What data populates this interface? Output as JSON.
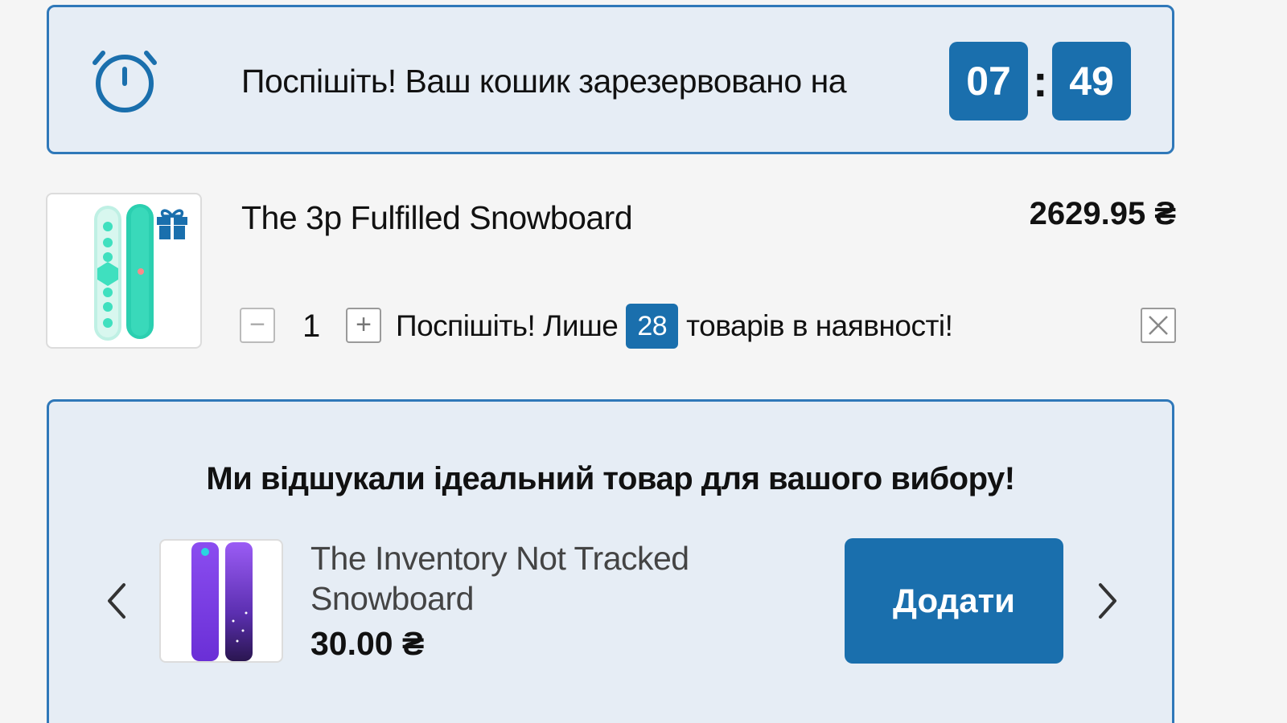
{
  "timer": {
    "message": "Поспішіть! Ваш кошик зарезервовано на",
    "minutes": "07",
    "separator": ":",
    "seconds": "49"
  },
  "cart_item": {
    "title": "The 3p Fulfilled Snowboard",
    "price": "2629.95 ₴",
    "quantity": "1",
    "decrease_label": "−",
    "increase_label": "+",
    "stock_prefix": "Поспішіть! Лише",
    "stock_count": "28",
    "stock_suffix": "товарів в наявності!",
    "has_gift_icon": true
  },
  "upsell": {
    "heading": "Ми відшукали ідеальний товар для вашого вибору!",
    "product_title": "The Inventory Not Tracked Snowboard",
    "product_price": "30.00 ₴",
    "add_button_label": "Додати"
  },
  "colors": {
    "accent": "#1a6fad",
    "border_accent": "#2f78b9",
    "panel_bg": "#e6edf5",
    "page_bg": "#f5f5f5"
  }
}
